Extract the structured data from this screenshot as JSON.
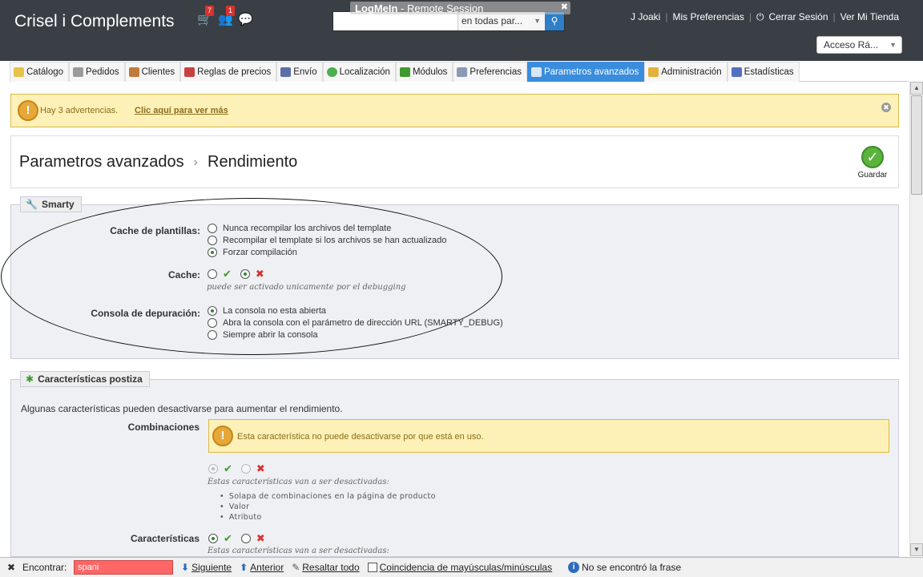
{
  "header": {
    "shop_name": "Crisel i Complements",
    "orders_count": "7",
    "customers_count": "1",
    "search_scope": "en todas par...",
    "logmein_title": "LogMeIn",
    "logmein_subtitle": " - Remote Session",
    "user": "J Joaki",
    "preferences": "Mis Preferencias",
    "logout": "Cerrar Sesión",
    "view_shop": "Ver Mi Tienda",
    "quick_access": "Acceso Rá..."
  },
  "menu": [
    {
      "label": "Catálogo",
      "color": "#e8c24a"
    },
    {
      "label": "Pedidos",
      "color": "#9a9a9a"
    },
    {
      "label": "Clientes",
      "color": "#c07a3a"
    },
    {
      "label": "Reglas de precios",
      "color": "#c94040"
    },
    {
      "label": "Envío",
      "color": "#5a6fa8"
    },
    {
      "label": "Localización",
      "color": "#4caf50"
    },
    {
      "label": "Módulos",
      "color": "#3f9a2e"
    },
    {
      "label": "Preferencias",
      "color": "#8a9ab5"
    },
    {
      "label": "Parametros avanzados",
      "color": "#ffffff"
    },
    {
      "label": "Administración",
      "color": "#e2b23a"
    },
    {
      "label": "Estadísticas",
      "color": "#5470c0"
    }
  ],
  "warning": {
    "text": "Hay 3 advertencias.",
    "link": "Clic aquí para ver más"
  },
  "title": {
    "section": "Parametros avanzados",
    "page": "Rendimiento",
    "save": "Guardar"
  },
  "smarty": {
    "legend": "Smarty",
    "cache_templates_label": "Cache de plantillas:",
    "cache_templates_options": [
      "Nunca recompilar los archivos del template",
      "Recompilar el template si los archivos se han actualizado",
      "Forzar compilación"
    ],
    "cache_label": "Cache:",
    "cache_hint": "puede ser activado unicamente por el debugging",
    "console_label": "Consola de depuración:",
    "console_options": [
      "La consola no esta abierta",
      "Abra la consola con el parámetro de dirección URL (SMARTY_DEBUG)",
      "Siempre abrir la consola"
    ]
  },
  "features": {
    "legend": "Características postiza",
    "intro": "Algunas características pueden desactivarse para aumentar el rendimiento.",
    "combinations_label": "Combinaciones",
    "combinations_warning": "Esta característica no puede desactivarse por que está en uso.",
    "deactivate_note": "Estas características van a ser desactivadas:",
    "combinations_items": [
      "Solapa de combinaciones en la página de producto",
      "Valor",
      "Atributo"
    ],
    "characteristics_label": "Características",
    "characteristics_note": "Estas características van a ser desactivadas:"
  },
  "findbar": {
    "label": "Encontrar:",
    "query": "spani",
    "next": "Siguiente",
    "prev": "Anterior",
    "highlight": "Resaltar todo",
    "match_case": "Coincidencia de mayúsculas/minúsculas",
    "status": "No se encontró la frase"
  }
}
